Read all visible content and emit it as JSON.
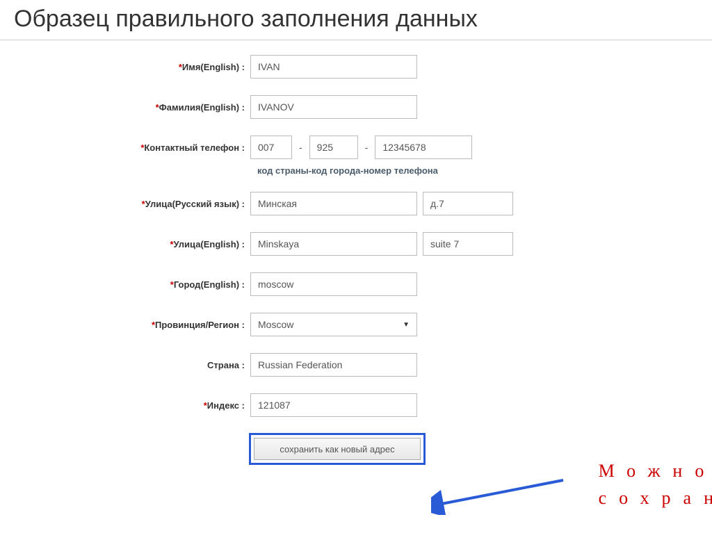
{
  "title": "Образец правильного заполнения данных",
  "form": {
    "name": {
      "label": "Имя(English)",
      "required": true,
      "value": "IVAN"
    },
    "surname": {
      "label": "Фамилия(English)",
      "required": true,
      "value": "IVANOV"
    },
    "phone": {
      "label": "Контактный телефон",
      "required": true,
      "country": "007",
      "city": "925",
      "number": "12345678",
      "hint": "код страны-код города-номер телефона"
    },
    "street_ru": {
      "label": "Улица(Русский язык)",
      "required": true,
      "value1": "Минская",
      "value2": "д.7"
    },
    "street_en": {
      "label": "Улица(English)",
      "required": true,
      "value1": "Minskaya",
      "value2": "suite 7"
    },
    "city_en": {
      "label": "Город(English)",
      "required": true,
      "value": "moscow"
    },
    "region": {
      "label": "Провинция/Регион",
      "required": true,
      "value": "Moscow"
    },
    "country": {
      "label": "Страна",
      "required": false,
      "value": "Russian Federation"
    },
    "postal": {
      "label": "Индекс",
      "required": true,
      "value": "121087"
    }
  },
  "save_button": "сохранить как новый адрес",
  "annotation": {
    "line1": "Можно",
    "line2": "сохран"
  }
}
